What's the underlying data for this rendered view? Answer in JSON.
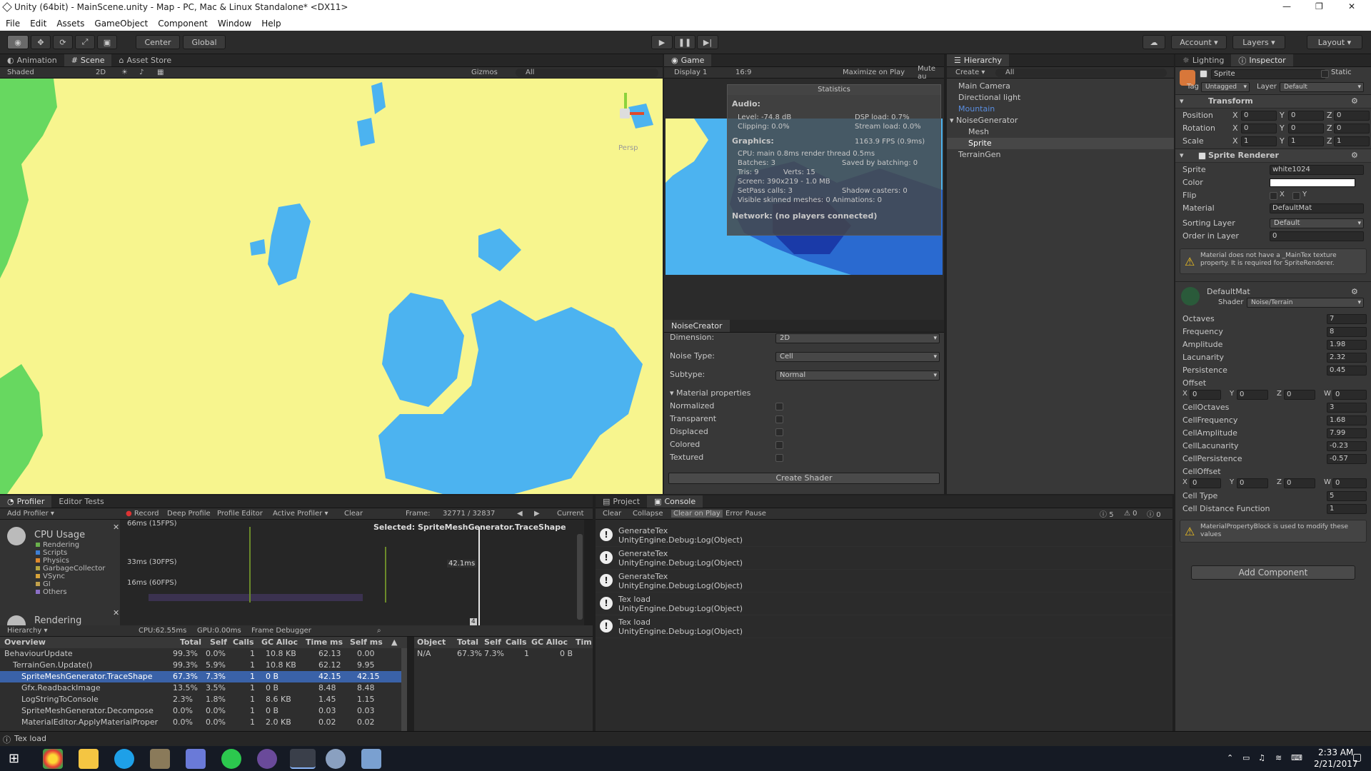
{
  "titlebar": {
    "title": "Unity (64bit) - MainScene.unity - Map - PC, Mac & Linux Standalone* <DX11>",
    "min": "—",
    "max": "❐",
    "close": "✕"
  },
  "menu": [
    "File",
    "Edit",
    "Assets",
    "GameObject",
    "Component",
    "Window",
    "Help"
  ],
  "toolbar": {
    "center": "Center",
    "global": "Global",
    "account": "Account",
    "layers": "Layers",
    "layout": "Layout"
  },
  "scene": {
    "tabs": [
      "Animation",
      "Scene",
      "Asset Store"
    ],
    "shaded": "Shaded",
    "mode2d": "2D",
    "gizmos": "Gizmos",
    "search_placeholder": "All",
    "persp": "Persp"
  },
  "game": {
    "tab": "Game",
    "display": "Display 1",
    "aspect": "16:9",
    "maximize": "Maximize on Play",
    "mute": "Mute au",
    "stats": {
      "title": "Statistics",
      "audio": "Audio:",
      "level": "Level: -74.8 dB",
      "dsp": "DSP load: 0.7%",
      "clipping": "Clipping: 0.0%",
      "stream": "Stream load: 0.0%",
      "graphics": "Graphics:",
      "fps": "1163.9 FPS (0.9ms)",
      "cpu": "CPU: main 0.8ms  render thread 0.5ms",
      "batches": "Batches: 3",
      "saved": "Saved by batching: 0",
      "tris": "Tris: 9",
      "verts": "Verts: 15",
      "screen": "Screen: 390x219 - 1.0 MB",
      "setpass": "SetPass calls: 3",
      "shadow": "Shadow casters: 0",
      "skinned": "Visible skinned meshes: 0  Animations: 0",
      "network": "Network: (no players connected)"
    }
  },
  "noise": {
    "tab": "NoiseCreator",
    "fields": [
      {
        "label": "Dimension:",
        "value": "2D"
      },
      {
        "label": "Noise Type:",
        "value": "Cell"
      },
      {
        "label": "Subtype:",
        "value": "Normal"
      }
    ],
    "matprops": "Material properties",
    "checks": [
      "Normalized",
      "Transparent",
      "Displaced",
      "Colored",
      "Textured"
    ],
    "create": "Create Shader"
  },
  "hierarchy": {
    "tab": "Hierarchy",
    "create": "Create",
    "search": "All",
    "items": [
      "Main Camera",
      "Directional light",
      "Mountain",
      "NoiseGenerator",
      "Mesh",
      "Sprite",
      "TerrainGen"
    ]
  },
  "inspector": {
    "tabs": [
      "Lighting",
      "Inspector"
    ],
    "name": "Sprite",
    "static": "Static",
    "tag_label": "Tag",
    "tag": "Untagged",
    "layer_label": "Layer",
    "layer": "Default",
    "transform": "Transform",
    "position": {
      "label": "Position",
      "x": "0",
      "y": "0",
      "z": "0"
    },
    "rotation": {
      "label": "Rotation",
      "x": "0",
      "y": "0",
      "z": "0"
    },
    "scale": {
      "label": "Scale",
      "x": "1",
      "y": "1",
      "z": "1"
    },
    "sprite_renderer": "Sprite Renderer",
    "sprite_label": "Sprite",
    "sprite": "white1024",
    "color_label": "Color",
    "flip_label": "Flip",
    "flip_x": "X",
    "flip_y": "Y",
    "material_label": "Material",
    "material": "DefaultMat",
    "sorting_label": "Sorting Layer",
    "sorting": "Default",
    "order_label": "Order in Layer",
    "order": "0",
    "warning1": "Material does not have a _MainTex texture property. It is required for SpriteRenderer.",
    "mat_name": "DefaultMat",
    "shader_label": "Shader",
    "shader": "Noise/Terrain",
    "props": [
      {
        "label": "Octaves",
        "value": "7"
      },
      {
        "label": "Frequency",
        "value": "8"
      },
      {
        "label": "Amplitude",
        "value": "1.98"
      },
      {
        "label": "Lacunarity",
        "value": "2.32"
      },
      {
        "label": "Persistence",
        "value": "0.45"
      }
    ],
    "offset_label": "Offset",
    "offset": {
      "x": "0",
      "y": "0",
      "z": "0",
      "w": "0"
    },
    "props2": [
      {
        "label": "CellOctaves",
        "value": "3"
      },
      {
        "label": "CellFrequency",
        "value": "1.68"
      },
      {
        "label": "CellAmplitude",
        "value": "7.99"
      },
      {
        "label": "CellLacunarity",
        "value": "-0.23"
      },
      {
        "label": "CellPersistence",
        "value": "-0.57"
      }
    ],
    "celloffset_label": "CellOffset",
    "celloffset": {
      "x": "0",
      "y": "0",
      "z": "0",
      "w": "0"
    },
    "celltype_label": "Cell Type",
    "celltype": "5",
    "celldist_label": "Cell Distance Function",
    "celldist": "1",
    "warning2": "MaterialPropertyBlock is used to modify these values",
    "add_component": "Add Component"
  },
  "profiler": {
    "tabs": [
      "Profiler",
      "Editor Tests"
    ],
    "add": "Add Profiler",
    "record": "Record",
    "deep": "Deep Profile",
    "editor": "Profile Editor",
    "active": "Active Profiler",
    "clear": "Clear",
    "frame_label": "Frame:",
    "frame": "32771 / 32837",
    "current": "Current",
    "cpu_title": "CPU Usage",
    "legend": [
      {
        "name": "Rendering",
        "color": "#6ab04c"
      },
      {
        "name": "Scripts",
        "color": "#3f7fd4"
      },
      {
        "name": "Physics",
        "color": "#e08a2c"
      },
      {
        "name": "GarbageCollector",
        "color": "#b5a642"
      },
      {
        "name": "VSync",
        "color": "#d8a33a"
      },
      {
        "name": "GI",
        "color": "#c2a04b"
      },
      {
        "name": "Others",
        "color": "#8b6fc6"
      }
    ],
    "rendering": "Rendering",
    "ms66": "66ms (15FPS)",
    "ms33": "33ms (30FPS)",
    "ms16": "16ms (60FPS)",
    "selected": "Selected: SpriteMeshGenerator.TraceShape",
    "marker": "42.1ms",
    "marker_small": "4",
    "view": "Hierarchy",
    "cpu": "CPU:62.55ms",
    "gpu": "GPU:0.00ms",
    "debugger": "Frame Debugger",
    "columns": [
      "Overview",
      "Total",
      "Self",
      "Calls",
      "GC Alloc",
      "Time ms",
      "Self ms"
    ],
    "rows": [
      {
        "name": "BehaviourUpdate",
        "total": "99.3%",
        "self": "0.0%",
        "calls": "1",
        "gc": "10.8 KB",
        "time": "62.13",
        "selfms": "0.00",
        "indent": 0
      },
      {
        "name": "TerrainGen.Update()",
        "total": "99.3%",
        "self": "5.9%",
        "calls": "1",
        "gc": "10.8 KB",
        "time": "62.12",
        "selfms": "9.95",
        "indent": 1
      },
      {
        "name": "SpriteMeshGenerator.TraceShape",
        "total": "67.3%",
        "self": "7.3%",
        "calls": "1",
        "gc": "0 B",
        "time": "42.15",
        "selfms": "42.15",
        "indent": 2
      },
      {
        "name": "Gfx.ReadbackImage",
        "total": "13.5%",
        "self": "3.5%",
        "calls": "1",
        "gc": "0 B",
        "time": "8.48",
        "selfms": "8.48",
        "indent": 2
      },
      {
        "name": "LogStringToConsole",
        "total": "2.3%",
        "self": "1.8%",
        "calls": "1",
        "gc": "8.6 KB",
        "time": "1.45",
        "selfms": "1.15",
        "indent": 2
      },
      {
        "name": "SpriteMeshGenerator.Decompose",
        "total": "0.0%",
        "self": "0.0%",
        "calls": "1",
        "gc": "0 B",
        "time": "0.03",
        "selfms": "0.03",
        "indent": 2
      },
      {
        "name": "MaterialEditor.ApplyMaterialProper",
        "total": "0.0%",
        "self": "0.0%",
        "calls": "1",
        "gc": "2.0 KB",
        "time": "0.02",
        "selfms": "0.02",
        "indent": 2
      }
    ],
    "obj_columns": [
      "Object",
      "Total",
      "Self",
      "Calls",
      "GC Alloc",
      "Tim"
    ],
    "obj_row": {
      "name": "N/A",
      "total": "67.3%",
      "self": "7.3%",
      "calls": "1",
      "gc": "0 B"
    }
  },
  "console": {
    "tabs": [
      "Project",
      "Console"
    ],
    "buttons": [
      "Clear",
      "Collapse",
      "Clear on Play",
      "Error Pause"
    ],
    "counts": {
      "log": "5",
      "warn": "0",
      "err": "0"
    },
    "entries": [
      {
        "l1": "GenerateTex",
        "l2": "UnityEngine.Debug:Log(Object)"
      },
      {
        "l1": "GenerateTex",
        "l2": "UnityEngine.Debug:Log(Object)"
      },
      {
        "l1": "GenerateTex",
        "l2": "UnityEngine.Debug:Log(Object)"
      },
      {
        "l1": "Tex load",
        "l2": "UnityEngine.Debug:Log(Object)"
      },
      {
        "l1": "Tex load",
        "l2": "UnityEngine.Debug:Log(Object)"
      }
    ]
  },
  "statusbar": "Tex load",
  "taskbar": {
    "time": "2:33 AM",
    "date": "2/21/2017"
  },
  "colors": {
    "land": "#f7f58e",
    "water": "#4cb3f0",
    "grass": "#67d860",
    "selected": "#3a62a8"
  }
}
